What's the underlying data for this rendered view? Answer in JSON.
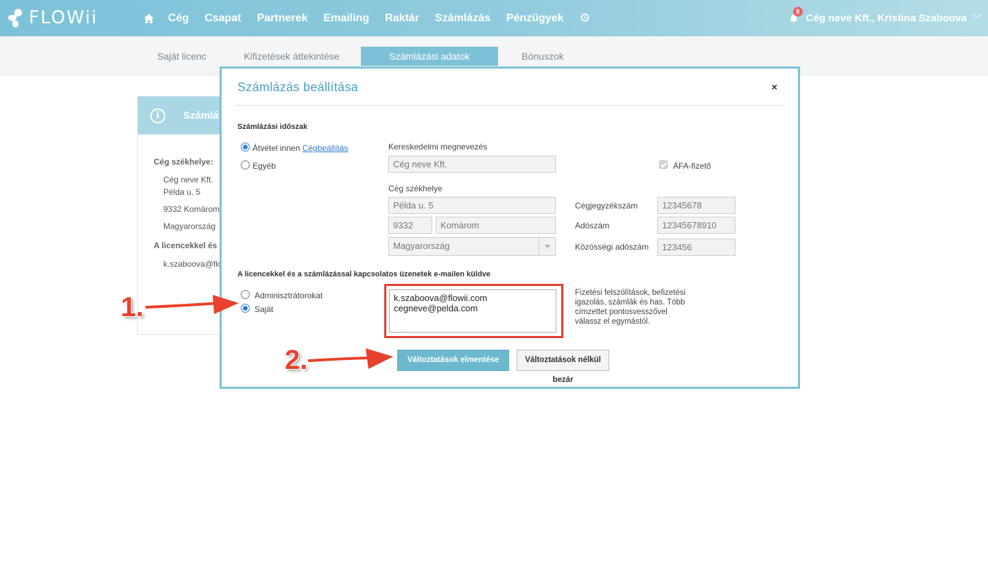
{
  "brand": {
    "logo_text": "FLOWii",
    "accent": "#7cc2d8",
    "title_color": "#4aa3bd",
    "highlight": "#e63b2e"
  },
  "nav": {
    "items": [
      "Cég",
      "Csapat",
      "Partnerek",
      "Emailing",
      "Raktár",
      "Számlázás",
      "Pénzügyek"
    ],
    "home_icon": "home-icon",
    "settings_icon": "gear-icon"
  },
  "account": {
    "notification_count": "9",
    "label": "Cég neve Kft., Kristina Szaboova"
  },
  "subnav": {
    "tabs": [
      "Saját licenc",
      "Kifizetések áttekintése",
      "Számlázási adatok",
      "Bónuszok"
    ],
    "active": "Számlázási adatok"
  },
  "background_card": {
    "header": "Számlá",
    "seat_label": "Cég székhelye:",
    "company": "Cég neve Kft.",
    "street": "Példa u. 5",
    "city_line": "9332   Komárom",
    "country": "Magyarország",
    "license_label": "A licencekkel és a",
    "email": "k.szaboova@flo"
  },
  "modal": {
    "title": "Számlázás beállítása",
    "close": "×",
    "period_heading": "Számlázási időszak",
    "radio_inherit": "Átvétel innen ",
    "radio_inherit_link": "Cégbeállítás",
    "radio_other": "Egyéb",
    "trade_name_label": "Kereskedelmi megnevezés",
    "trade_name_value": "Cég neve Kft.",
    "vat_payer_label": "ÁFA-fizető",
    "seat_label": "Cég székhelye",
    "street_value": "Példa u. 5",
    "zip_value": "9332",
    "city_value": "Komárom",
    "country_value": "Magyarország",
    "reg_no_label": "Cégjegyzékszám",
    "reg_no_value": "12345678",
    "tax_no_label": "Adószám",
    "tax_no_value": "12345678910",
    "eu_tax_label": "Közösségi adószám",
    "eu_tax_value": "123456",
    "email_heading": "A licencekkel és a számlázással kapcsolatos üzenetek e-mailen küldve",
    "radio_admins": "Adminisztrátorokat",
    "radio_own": "Saját",
    "emails_line1": "k.szaboova@flowii.com",
    "emails_line2": "cegneve@pelda.com",
    "help_text": "Fizetési felszólítások, befizetési igazolás, számlák és has. Több címzettet pontosvesszővel válassz el egymástól.",
    "save_button": "Változtatások elmentése",
    "close_button": "Változtatások nélkül bezár"
  },
  "annotations": {
    "step1": "1.",
    "step2": "2."
  }
}
